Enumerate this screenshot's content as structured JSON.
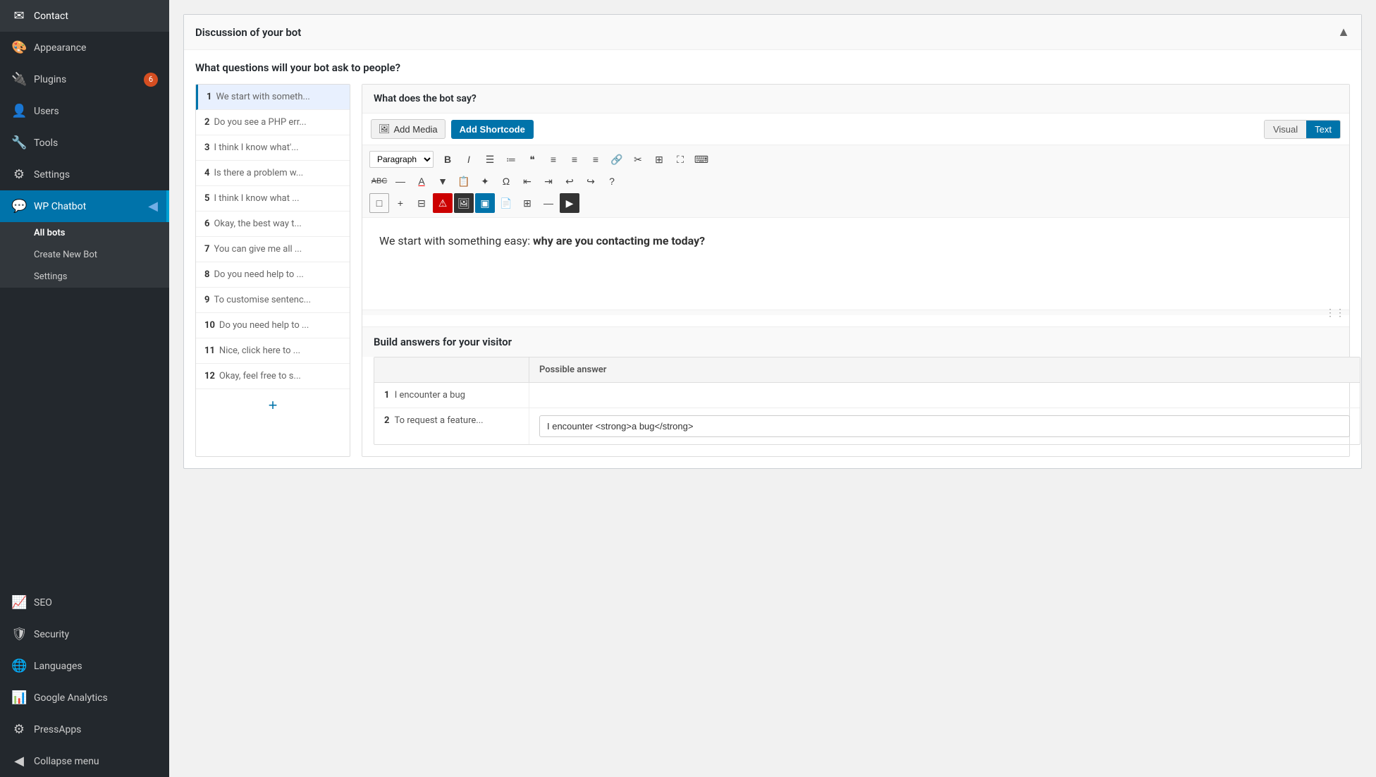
{
  "sidebar": {
    "items": [
      {
        "id": "contact",
        "label": "Contact",
        "icon": "✉",
        "active": false,
        "badge": null
      },
      {
        "id": "appearance",
        "label": "Appearance",
        "icon": "🎨",
        "active": false,
        "badge": null
      },
      {
        "id": "plugins",
        "label": "Plugins",
        "icon": "🔌",
        "active": false,
        "badge": 6
      },
      {
        "id": "users",
        "label": "Users",
        "icon": "👤",
        "active": false,
        "badge": null
      },
      {
        "id": "tools",
        "label": "Tools",
        "icon": "🔧",
        "active": false,
        "badge": null
      },
      {
        "id": "settings",
        "label": "Settings",
        "icon": "⚙",
        "active": false,
        "badge": null
      },
      {
        "id": "wp-chatbot",
        "label": "WP Chatbot",
        "icon": "💬",
        "active": true,
        "badge": null
      }
    ],
    "submenu": {
      "parentId": "wp-chatbot",
      "items": [
        {
          "id": "all-bots",
          "label": "All bots",
          "active": true
        },
        {
          "id": "create-new-bot",
          "label": "Create New Bot",
          "active": false
        },
        {
          "id": "settings",
          "label": "Settings",
          "active": false
        }
      ]
    },
    "bottom_items": [
      {
        "id": "seo",
        "label": "SEO",
        "icon": "📈",
        "active": false,
        "badge": null
      },
      {
        "id": "security",
        "label": "Security",
        "icon": "🛡",
        "active": false,
        "badge": null
      },
      {
        "id": "languages",
        "label": "Languages",
        "icon": "🌐",
        "active": false,
        "badge": null
      },
      {
        "id": "google-analytics",
        "label": "Google Analytics",
        "icon": "📊",
        "active": false,
        "badge": null
      },
      {
        "id": "pressapps",
        "label": "PressApps",
        "icon": "⚙",
        "active": false,
        "badge": null
      },
      {
        "id": "collapse-menu",
        "label": "Collapse menu",
        "icon": "◀",
        "active": false,
        "badge": null
      }
    ]
  },
  "panel": {
    "title": "Discussion of your bot",
    "questions_label": "What questions will your bot ask to people?",
    "questions": [
      {
        "num": 1,
        "text": "We start with someth..."
      },
      {
        "num": 2,
        "text": "Do you see a PHP err..."
      },
      {
        "num": 3,
        "text": "I think I know what'..."
      },
      {
        "num": 4,
        "text": "Is there a problem w..."
      },
      {
        "num": 5,
        "text": "I think I know what ..."
      },
      {
        "num": 6,
        "text": "Okay, the best way t..."
      },
      {
        "num": 7,
        "text": "You can give me all ..."
      },
      {
        "num": 8,
        "text": "Do you need help to ..."
      },
      {
        "num": 9,
        "text": "To customise sentenc..."
      },
      {
        "num": 10,
        "text": "Do you need help to ..."
      },
      {
        "num": 11,
        "text": "Nice, click here to ..."
      },
      {
        "num": 12,
        "text": "Okay, feel free to s..."
      }
    ],
    "add_question_icon": "+",
    "editor": {
      "title": "What does the bot say?",
      "add_media_label": "Add Media",
      "add_shortcode_label": "Add Shortcode",
      "view_tabs": [
        {
          "id": "visual",
          "label": "Visual",
          "active": false
        },
        {
          "id": "text",
          "label": "Text",
          "active": true
        }
      ],
      "toolbar_row1": [
        {
          "id": "paragraph-select",
          "type": "select",
          "value": "Paragraph"
        },
        {
          "id": "bold",
          "icon": "𝐁",
          "title": "Bold"
        },
        {
          "id": "italic",
          "icon": "𝐼",
          "title": "Italic"
        },
        {
          "id": "ul",
          "icon": "≡",
          "title": "Unordered List"
        },
        {
          "id": "ol",
          "icon": "≔",
          "title": "Ordered List"
        },
        {
          "id": "blockquote",
          "icon": "❝",
          "title": "Blockquote"
        },
        {
          "id": "align-left",
          "icon": "☰",
          "title": "Align Left"
        },
        {
          "id": "align-center",
          "icon": "≡",
          "title": "Align Center"
        },
        {
          "id": "align-right",
          "icon": "≡",
          "title": "Align Right"
        },
        {
          "id": "link",
          "icon": "🔗",
          "title": "Link"
        },
        {
          "id": "unlink",
          "icon": "✂",
          "title": "Unlink"
        },
        {
          "id": "table",
          "icon": "⊞",
          "title": "Table"
        },
        {
          "id": "fullscreen",
          "icon": "⛶",
          "title": "Fullscreen"
        },
        {
          "id": "code",
          "icon": "⌨",
          "title": "Code"
        }
      ],
      "toolbar_row2": [
        {
          "id": "strikethrough",
          "icon": "ABC̶",
          "title": "Strikethrough"
        },
        {
          "id": "hr",
          "icon": "—",
          "title": "Horizontal Rule"
        },
        {
          "id": "font-color",
          "icon": "A",
          "title": "Font Color"
        },
        {
          "id": "paste-text",
          "icon": "📋",
          "title": "Paste as Text"
        },
        {
          "id": "clear-format",
          "icon": "✦",
          "title": "Clear Formatting"
        },
        {
          "id": "special-char",
          "icon": "Ω",
          "title": "Special Character"
        },
        {
          "id": "indent",
          "icon": "⇥",
          "title": "Decrease Indent"
        },
        {
          "id": "outdent",
          "icon": "⇤",
          "title": "Increase Indent"
        },
        {
          "id": "undo",
          "icon": "↩",
          "title": "Undo"
        },
        {
          "id": "redo",
          "icon": "↪",
          "title": "Redo"
        },
        {
          "id": "help",
          "icon": "?",
          "title": "Help"
        }
      ],
      "toolbar_row3": [
        {
          "id": "format-box",
          "icon": "□",
          "title": "Format"
        },
        {
          "id": "plus",
          "icon": "+",
          "title": "Add"
        },
        {
          "id": "table2",
          "icon": "⊟",
          "title": "Table2"
        },
        {
          "id": "warning",
          "icon": "⚠",
          "title": "Warning",
          "highlight": "red"
        },
        {
          "id": "media-box",
          "icon": "🖼",
          "title": "Media"
        },
        {
          "id": "highlight-box",
          "icon": "▣",
          "title": "Highlight",
          "highlight": "blue"
        },
        {
          "id": "copy",
          "icon": "📄",
          "title": "Copy"
        },
        {
          "id": "grid",
          "icon": "⊞",
          "title": "Grid"
        },
        {
          "id": "minus",
          "icon": "—",
          "title": "Separator"
        },
        {
          "id": "media-play",
          "icon": "▶",
          "title": "Play"
        }
      ],
      "content_text_before": "We start with something easy: ",
      "content_text_bold": "why are you contacting me today?"
    },
    "answers": {
      "label": "Build answers for your visitor",
      "col1_header": "",
      "col2_header": "Possible answer",
      "rows": [
        {
          "num": 1,
          "question": "I encounter a bug",
          "answer": ""
        },
        {
          "num": 2,
          "question": "To request a feature...",
          "answer": "I encounter <strong>a bug</strong>"
        }
      ]
    }
  }
}
